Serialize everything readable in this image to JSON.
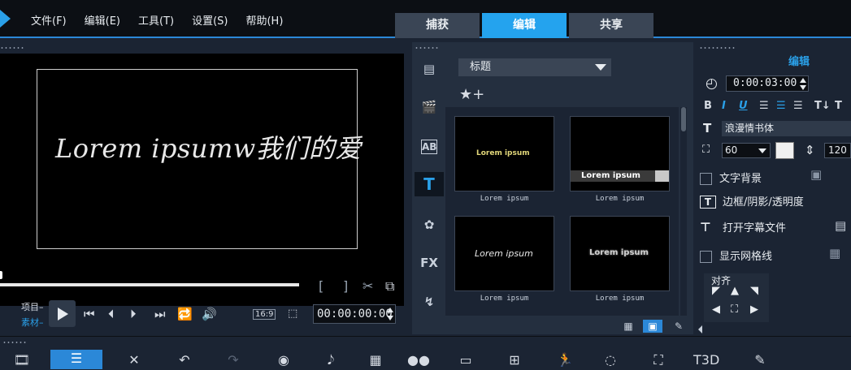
{
  "menu": {
    "items": [
      "文件(F)",
      "编辑(E)",
      "工具(T)",
      "设置(S)",
      "帮助(H)"
    ],
    "mode_tabs": [
      "捕获",
      "编辑",
      "共享"
    ],
    "active_tab": "编辑"
  },
  "preview": {
    "overlay_text": "Lorem ipsumw我们的爱",
    "label_project": "项目",
    "label_clip": "素材",
    "aspect_ratio": "16:9",
    "timecode": "00:00:00:00"
  },
  "library": {
    "category": "标题",
    "categories_icons": [
      "media-icon",
      "instant-project-icon",
      "transition-icon",
      "title-icon",
      "graphics-icon",
      "filter-icon",
      "path-icon"
    ],
    "fx_label": "FX",
    "thumbnails": [
      {
        "text": "Lorem ipsum",
        "caption": "Lorem ipsum"
      },
      {
        "text": "Lorem ipsum",
        "caption": "Lorem ipsum"
      },
      {
        "text": "Lorem ipsum",
        "caption": "Lorem ipsum"
      },
      {
        "text": "Lorem ipsum",
        "caption": "Lorem ipsum"
      }
    ]
  },
  "options": {
    "title": "编辑",
    "duration": "0:00:03:00",
    "format_buttons": [
      "B",
      "I",
      "U"
    ],
    "font_name": "浪漫情书体",
    "font_size": "60",
    "line_spacing": "120",
    "text_background": "文字背景",
    "border_shadow": "边框/阴影/透明度",
    "open_subtitle": "打开字幕文件",
    "show_grid": "显示网格线",
    "alignment_label": "对齐",
    "text_color": "#f0f0f0"
  },
  "colors": {
    "accent": "#24a3ee",
    "background": "#1b2433",
    "panel": "#242f3f"
  }
}
